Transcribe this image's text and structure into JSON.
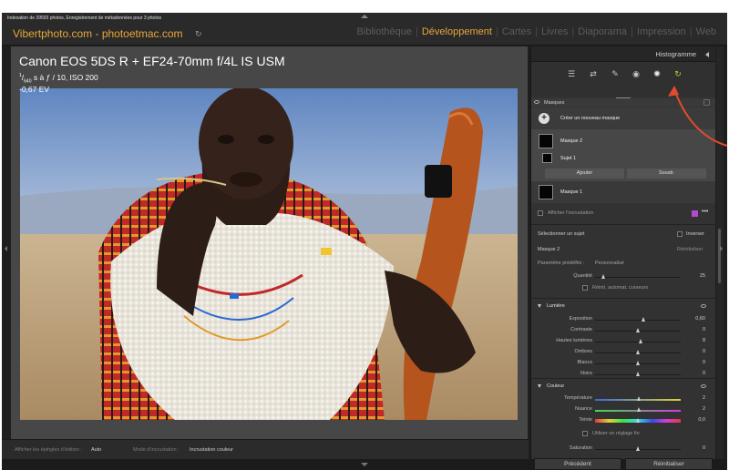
{
  "status_text": "Indexation de 39593 photos, Enregistrement de métadonnées pour 3 photos",
  "brand": "Vibertphoto.com - photoetmac.com",
  "modules": [
    "Bibliothèque",
    "Développement",
    "Cartes",
    "Livres",
    "Diaporama",
    "Impression",
    "Web"
  ],
  "active_module": "Développement",
  "photo_info": {
    "camera": "Canon EOS 5DS R + EF24-70mm f/4L IS USM",
    "shutter_num": "1",
    "shutter_den": "640",
    "exposure_rest": " s à ƒ / 10, ISO 200",
    "ev": "-0,67 EV"
  },
  "toolbar": {
    "show_pins_label": "Afficher les épingles d'édition :",
    "show_pins_value": "Auto",
    "overlay_mode_label": "Mode d'incrustation :",
    "overlay_mode_value": "Incrustation couleur"
  },
  "panel": {
    "histogram": "Histogramme",
    "tools": [
      "sliders-icon",
      "crop-rotate-icon",
      "healing-icon",
      "red-eye-icon",
      "masking-icon",
      "presets-icon"
    ],
    "masks_title": "Masques",
    "create_mask": "Créer un nouveau masque",
    "mask2": "Masque 2",
    "subject1": "Sujet 1",
    "add": "Ajouter",
    "subtract": "Soustr.",
    "mask1": "Masque 1",
    "show_overlay": "Afficher l'incrustation",
    "select_subject": "Sélectionner un sujet",
    "invert": "Inverser",
    "current_mask": "Masque 2",
    "reset": "Réinitialiser",
    "preset_label": "Paramètre prédéfini :",
    "preset_value": "Personnalisé",
    "amount_label": "Quantité",
    "amount_value": "25",
    "auto_reset": "Réinit. automat. curseurs",
    "accent_color": "#b248d6"
  },
  "light": {
    "title": "Lumière",
    "sliders": [
      {
        "label": "Exposition",
        "value": "0,60",
        "pos": 0.57
      },
      {
        "label": "Contraste",
        "value": "0",
        "pos": 0.5
      },
      {
        "label": "Hautes lumières",
        "value": "8",
        "pos": 0.54
      },
      {
        "label": "Ombres",
        "value": "0",
        "pos": 0.5
      },
      {
        "label": "Blancs",
        "value": "0",
        "pos": 0.5
      },
      {
        "label": "Noirs",
        "value": "0",
        "pos": 0.5
      }
    ]
  },
  "color": {
    "title": "Couleur",
    "sliders": [
      {
        "label": "Température",
        "value": "2",
        "pos": 0.52
      },
      {
        "label": "Nuance",
        "value": "2",
        "pos": 0.52
      },
      {
        "label": "Teinte",
        "value": "0,0",
        "pos": 0.5
      }
    ],
    "hue_fine": "Utiliser un réglage fin",
    "saturation_label": "Saturation",
    "saturation_value": "0"
  },
  "buttons": {
    "previous": "Précédent",
    "reset": "Réinitialiser"
  }
}
